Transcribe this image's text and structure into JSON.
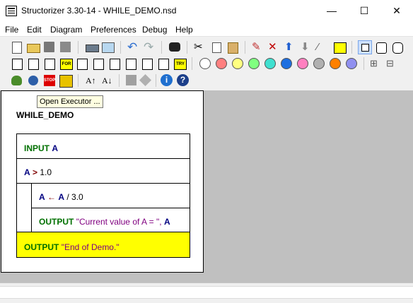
{
  "window": {
    "title": "Structorizer 3.30-14 - WHILE_DEMO.nsd",
    "minimize": "—",
    "maximize": "☐",
    "close": "✕"
  },
  "menu": [
    "File",
    "Edit",
    "Diagram",
    "Preferences",
    "Debug",
    "Help"
  ],
  "toolbar": {
    "color_palette": [
      "#ffffff",
      "#ff8080",
      "#ffff80",
      "#80ff80",
      "#40e0d0",
      "#1e6fe0",
      "#ff80c0",
      "#b0b0b0",
      "#ff8000",
      "#9090f0"
    ],
    "font_up_label": "A↑",
    "font_down_label": "A↓",
    "info_label": "i",
    "help_label": "?"
  },
  "tooltip": "Open Executor ...",
  "diagram": {
    "title": "WHILE_DEMO",
    "input_kw": "INPUT",
    "input_var": "A",
    "while_var": "A",
    "while_op": ">",
    "while_value": "1.0",
    "assign_var": "A",
    "assign_op": "←",
    "assign_expr_var": "A",
    "assign_expr_rest": "/ 3.0",
    "output1_kw": "OUTPUT",
    "output1_str": "\"Current value of A = \",",
    "output1_var": "A",
    "output2_kw": "OUTPUT",
    "output2_str": "\"End of Demo.\"",
    "output2_bg": "#ffff00"
  }
}
